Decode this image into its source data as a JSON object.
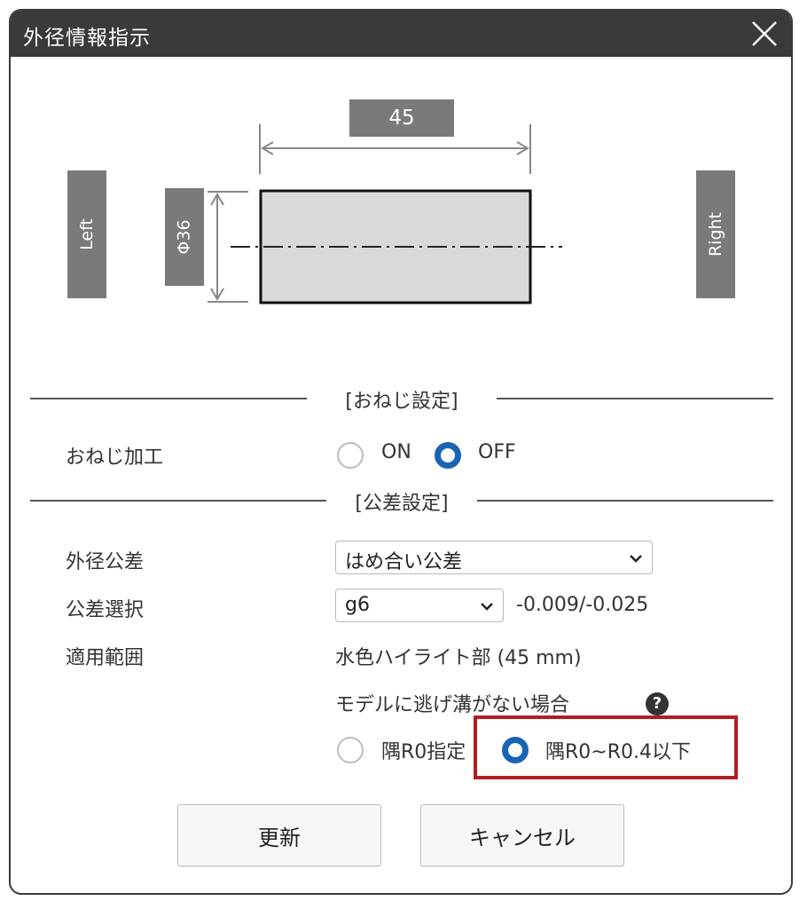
{
  "dialog": {
    "title": "外径情報指示",
    "close_icon": "close-icon"
  },
  "diagram": {
    "left_label": "Left",
    "right_label": "Right",
    "length_label": "45",
    "diameter_label": "Φ36"
  },
  "thread_section": {
    "header": "[おねじ設定]",
    "row_label": "おねじ加工",
    "options": [
      {
        "label": "ON",
        "checked": false
      },
      {
        "label": "OFF",
        "checked": true
      }
    ]
  },
  "tolerance_section": {
    "header": "[公差設定]",
    "outer_tolerance_label": "外径公差",
    "outer_tolerance_value": "はめ合い公差",
    "tolerance_select_label": "公差選択",
    "tolerance_select_value": "g6",
    "tolerance_range": "-0.009/-0.025",
    "applied_range_label": "適用範囲",
    "applied_range_value": "水色ハイライト部 (45 mm)",
    "no_groove_label": "モデルに逃げ溝がない場合",
    "help_icon": "help-icon",
    "corner_options": [
      {
        "label": "隅R0指定",
        "checked": false
      },
      {
        "label": "隅R0~R0.4以下",
        "checked": true
      }
    ]
  },
  "buttons": {
    "update_label": "更新",
    "cancel_label": "キャンセル"
  },
  "colors": {
    "titlebar": "#3a3a3a",
    "accent_radio": "#1a64b4",
    "highlight_box": "#b01e22",
    "label_gray": "#7a7a7a"
  }
}
